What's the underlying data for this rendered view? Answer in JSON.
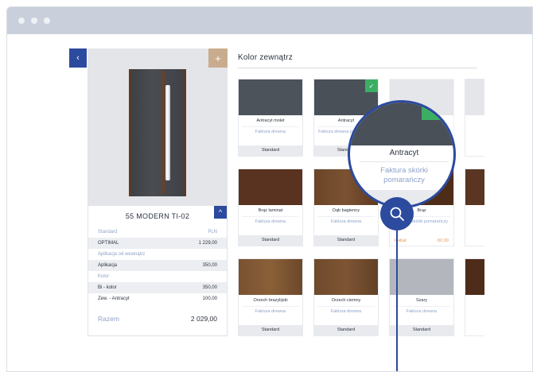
{
  "product": {
    "name": "55 MODERN TI-02",
    "prev_icon": "‹",
    "plus_icon": "+",
    "collapse_icon": "^"
  },
  "summary": {
    "header_left": "Standard",
    "header_right": "PLN",
    "rows": [
      {
        "type": "value",
        "label": "OPTIMAL",
        "value": "1 229,00"
      },
      {
        "type": "section",
        "label": "Aplikacja od wewnątrz",
        "value": ""
      },
      {
        "type": "value",
        "label": "Aplikacja",
        "value": "350,00"
      },
      {
        "type": "section",
        "label": "Kolor",
        "value": ""
      },
      {
        "type": "value",
        "label": "Bi - kolor",
        "value": "350,00"
      },
      {
        "type": "value",
        "label": "Zew. - Antracyt",
        "value": "100,00"
      }
    ],
    "total_label": "Razem",
    "total_value": "2 029,00"
  },
  "section_title": "Kolor zewnątrz",
  "colors": [
    {
      "name": "Antracyt molet",
      "sub": "Faktura drewna",
      "footer": "Standard",
      "color": "#4d535b"
    },
    {
      "name": "Antracyt",
      "sub": "Faktura drewna pomarańczy",
      "footer": "Standard",
      "color": "#4a5058",
      "selected": true
    },
    {
      "name": "",
      "sub": "",
      "footer": "",
      "color": "#e4e6ea"
    },
    {
      "name": "Brąz laminat",
      "sub": "Faktura drewna",
      "footer": "Standard",
      "color": "#5a3220"
    },
    {
      "name": "Dąb bagienny",
      "sub": "Faktura drewna",
      "footer": "Standard",
      "color": "#6b4428"
    },
    {
      "name": "Brąz",
      "sub": "Faktura skórki pomarańczy",
      "footer": "",
      "promo_label": "Rabat",
      "promo_value": "-50,00",
      "color": "#4e2c1a"
    },
    {
      "name": "Orzech brazylijski",
      "sub": "Faktura drewna",
      "footer": "Standard",
      "color": "#7a5232"
    },
    {
      "name": "Orzech ciemny",
      "sub": "Faktura drewna",
      "footer": "Standard",
      "color": "#6f4a2c"
    },
    {
      "name": "Szary",
      "sub": "Faktura drewna",
      "footer": "Standard",
      "color": "#b3b7bd"
    }
  ],
  "magnifier": {
    "name": "Antracyt",
    "sub_line1": "Faktura skórki",
    "sub_line2": "pomarańczy",
    "check_icon": "✓"
  },
  "palette": {
    "accent": "#2c4a9e",
    "selected": "#3cae64",
    "promo": "#e49a5a",
    "muted": "#8fa2c9"
  }
}
